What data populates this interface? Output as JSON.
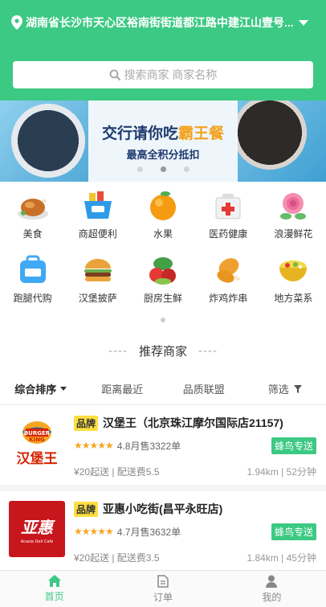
{
  "header": {
    "location": "湖南省长沙市天心区裕南街街道都江路中建江山壹号...",
    "search_placeholder": "搜索商家 商家名称"
  },
  "banner": {
    "title_main": "交行请你吃",
    "title_highlight": "霸王餐",
    "subtitle": "最高全积分抵扣",
    "slide_count": 3,
    "active_slide": 1
  },
  "categories": [
    {
      "label": "美食",
      "icon": "roast-chicken-icon"
    },
    {
      "label": "商超便利",
      "icon": "shopping-basket-icon"
    },
    {
      "label": "水果",
      "icon": "orange-icon"
    },
    {
      "label": "医药健康",
      "icon": "medicine-box-icon"
    },
    {
      "label": "浪漫鲜花",
      "icon": "flower-icon"
    },
    {
      "label": "跑腿代购",
      "icon": "errand-bag-icon"
    },
    {
      "label": "汉堡披萨",
      "icon": "burger-icon"
    },
    {
      "label": "厨房生鲜",
      "icon": "vegetables-icon"
    },
    {
      "label": "炸鸡炸串",
      "icon": "fried-chicken-icon"
    },
    {
      "label": "地方菜系",
      "icon": "rice-bowl-icon"
    }
  ],
  "recommend": {
    "title": "推荐商家",
    "dash": "----"
  },
  "sort": {
    "items": [
      "综合排序",
      "距离最近",
      "品质联盟",
      "筛选"
    ]
  },
  "shops": [
    {
      "badge": "品牌",
      "name": "汉堡王（北京珠江摩尔国际店21157)",
      "rating_text": "4.8月售3322单",
      "rating": 4.8,
      "delivery_badge": "蜂鸟专送",
      "fee_text": "¥20起送 | 配送费5.5",
      "distance_text": "1.94km | 52分钟",
      "logo": "burger-king-logo"
    },
    {
      "badge": "品牌",
      "name": "亚惠小吃街(昌平永旺店)",
      "rating_text": "4.7月售3632单",
      "rating": 4.7,
      "delivery_badge": "蜂鸟专送",
      "fee_text": "¥20起送 | 配送费3.5",
      "distance_text": "1.84km | 45分钟",
      "logo": "yahui-logo"
    }
  ],
  "tabs": [
    {
      "label": "首页",
      "icon": "home-icon",
      "active": true
    },
    {
      "label": "订单",
      "icon": "order-icon",
      "active": false
    },
    {
      "label": "我的",
      "icon": "user-icon",
      "active": false
    }
  ],
  "colors": {
    "brand_green": "#3cc983",
    "brand_badge_yellow": "#fcdf3f",
    "star_orange": "#f5a623"
  }
}
